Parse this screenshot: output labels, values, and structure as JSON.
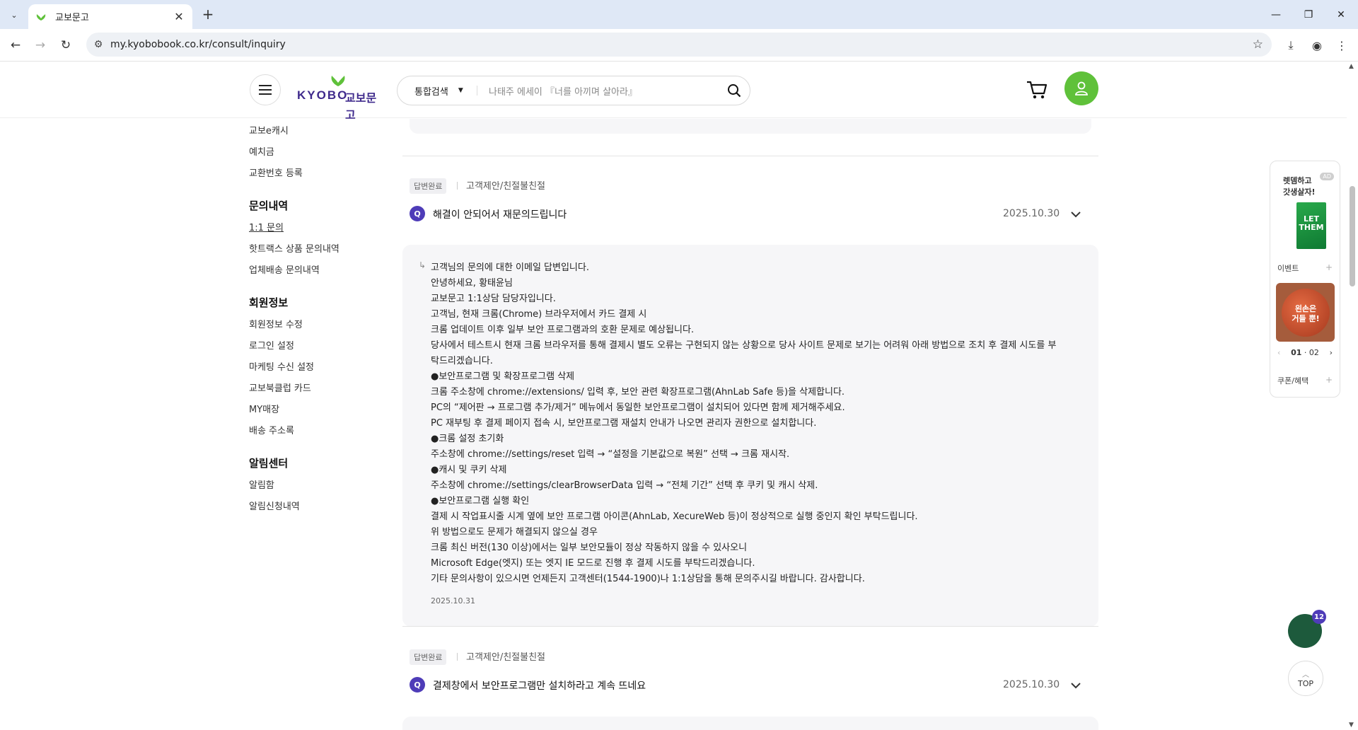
{
  "browser": {
    "tab_title": "교보문고",
    "url": "my.kyobobook.co.kr/consult/inquiry"
  },
  "header": {
    "logo_en": "KYOBO",
    "logo_ko": "교보문고",
    "search_scope": "통합검색",
    "search_placeholder": "나태주 에세이 『너를 아끼며 살아라』",
    "brand_color": "#5fc13a",
    "accent_color": "#4e3cb8"
  },
  "sidebar": {
    "items_top": [
      "교보e캐시",
      "예치금",
      "교환번호 등록"
    ],
    "sections": [
      {
        "title": "문의내역",
        "items": [
          "1:1 문의",
          "핫트랙스 상품 문의내역",
          "업체배송 문의내역"
        ]
      },
      {
        "title": "회원정보",
        "items": [
          "회원정보 수정",
          "로그인 설정",
          "마케팅 수신 설정",
          "교보북클럽 카드",
          "MY매장",
          "배송 주소록"
        ]
      },
      {
        "title": "알림센터",
        "items": [
          "알림함",
          "알림신청내역"
        ]
      }
    ],
    "active_item": "1:1 문의"
  },
  "inquiries": [
    {
      "status": "답변완료",
      "category": "고객제안/친절불친절",
      "q_icon": "Q",
      "title": "해결이 안되어서 재문의드립니다",
      "date": "2025.10.30",
      "answer_lines": [
        "고객님의 문의에 대한 이메일 답변입니다.",
        "안녕하세요, 황태윤님",
        "교보문고 1:1상담 담당자입니다.",
        "고객님, 현재 크롬(Chrome) 브라우저에서 카드 결제 시",
        "크롬 업데이트 이후 일부 보안 프로그램과의 호환 문제로 예상됩니다.",
        "당사에서 테스트시 현재 크롬 브라우저를 통해 결제시 별도 오류는 구현되지 않는 상황으로 당사 사이트 문제로 보기는 어려워 아래 방법으로 조치 후 결제 시도를 부",
        "탁드리겠습니다.",
        "●보안프로그램 및 확장프로그램 삭제",
        "크롬 주소창에 chrome://extensions/ 입력 후, 보안 관련 확장프로그램(AhnLab Safe 등)을 삭제합니다.",
        "PC의 “제어판 → 프로그램 추가/제거” 메뉴에서 동일한 보안프로그램이 설치되어 있다면 함께 제거해주세요.",
        "PC 재부팅 후 결제 페이지 접속 시, 보안프로그램 재설치 안내가 나오면 관리자 권한으로 설치합니다.",
        "●크롬 설정 초기화",
        "주소창에 chrome://settings/reset 입력 → “설정을 기본값으로 복원” 선택 → 크롬 재시작.",
        "●캐시 및 쿠키 삭제",
        "주소창에 chrome://settings/clearBrowserData 입력 → “전체 기간” 선택 후 쿠키 및 캐시 삭제.",
        "●보안프로그램 실행 확인",
        "결제 시 작업표시줄 시계 옆에 보안 프로그램 아이콘(AhnLab, XecureWeb 등)이 정상적으로 실행 중인지 확인 부탁드립니다.",
        "위 방법으로도 문제가 해결되지 않으실 경우",
        "크롬 최신 버전(130 이상)에서는 일부 보안모듈이 정상 작동하지 않을 수 있사오니",
        "Microsoft Edge(엣지) 또는 엣지 IE 모드로 진행 후 결제 시도를 부탁드리겠습니다.",
        "기타 문의사항이 있으시면 언제든지 고객센터(1544-1900)나 1:1상담을 통해 문의주시길 바랍니다. 감사합니다."
      ],
      "answer_date": "2025.10.31"
    },
    {
      "status": "답변완료",
      "category": "고객제안/친절불친절",
      "q_icon": "Q",
      "title": "결제창에서 보안프로그램만 설치하라고 계속 뜨네요",
      "date": "2025.10.30"
    }
  ],
  "right_panel": {
    "ad_tag": "AD",
    "ad_text_1": "렛뎀하고",
    "ad_text_2": "갓생살자!",
    "book_text_1": "LET",
    "book_text_2": "THEM",
    "event_label": "이벤트",
    "event_text_1": "왼손은",
    "event_text_2": "거들 뿐!",
    "page_current": "01",
    "page_sep": " · ",
    "page_total": "02",
    "coupon_label": "쿠폰/혜택"
  },
  "floating": {
    "chat_count": "12",
    "top_label": "TOP"
  }
}
